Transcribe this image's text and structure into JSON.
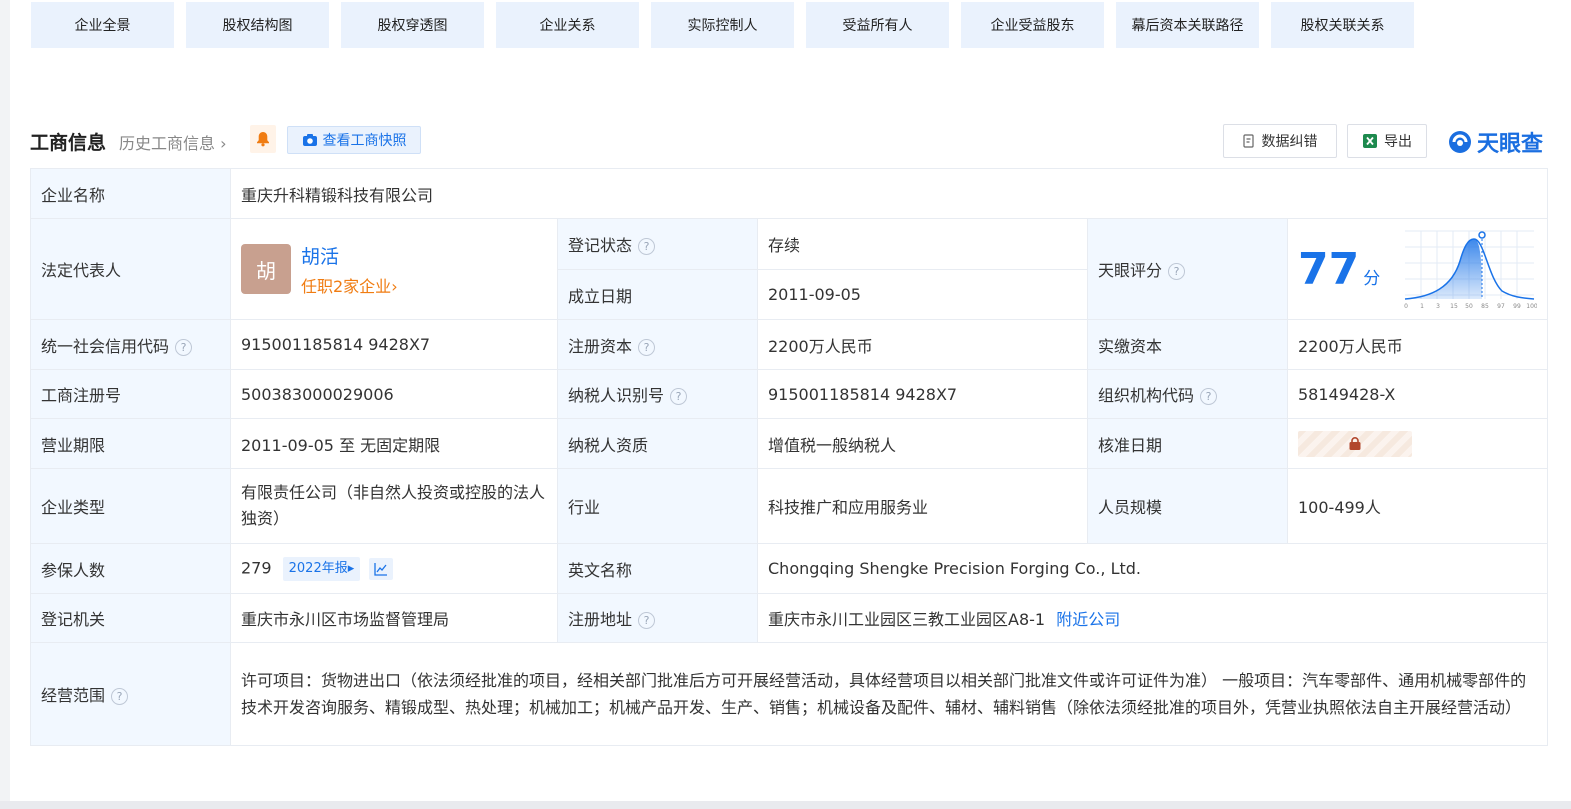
{
  "tabs": [
    "企业全景",
    "股权结构图",
    "股权穿透图",
    "企业关系",
    "实际控制人",
    "受益所有人",
    "企业受益股东",
    "幕后资本关联路径",
    "股权关联关系"
  ],
  "header": {
    "title": "工商信息",
    "history": "历史工商信息",
    "snapshot": "查看工商快照",
    "correct": "数据纠错",
    "export": "导出",
    "logo": "天眼查"
  },
  "info": {
    "company_name_label": "企业名称",
    "company_name": "重庆升科精锻科技有限公司",
    "legal_rep_label": "法定代表人",
    "legal_rep_avatar": "胡",
    "legal_rep_name": "胡活",
    "legal_rep_sub": "任职2家企业",
    "reg_status_label": "登记状态",
    "reg_status": "存续",
    "found_date_label": "成立日期",
    "found_date": "2011-09-05",
    "score_label": "天眼评分",
    "score": "77",
    "score_unit": "分",
    "score_ticks": [
      "0",
      "1",
      "3",
      "15",
      "50",
      "85",
      "97",
      "99",
      "100"
    ],
    "credit_code_label": "统一社会信用代码",
    "credit_code": "915001185814 9428X7",
    "reg_capital_label": "注册资本",
    "reg_capital": "2200万人民币",
    "paid_capital_label": "实缴资本",
    "paid_capital": "2200万人民币",
    "reg_no_label": "工商注册号",
    "reg_no": "500383000029006",
    "taxpayer_id_label": "纳税人识别号",
    "taxpayer_id": "915001185814 9428X7",
    "org_code_label": "组织机构代码",
    "org_code": "58149428-X",
    "term_label": "营业期限",
    "term": "2011-09-05 至 无固定期限",
    "tax_quality_label": "纳税人资质",
    "tax_quality": "增值税一般纳税人",
    "approve_date_label": "核准日期",
    "type_label": "企业类型",
    "type": "有限责任公司（非自然人投资或控股的法人独资）",
    "industry_label": "行业",
    "industry": "科技推广和应用服务业",
    "staff_label": "人员规模",
    "staff": "100-499人",
    "insured_label": "参保人数",
    "insured": "279",
    "insured_year": "2022年报",
    "en_name_label": "英文名称",
    "en_name": "Chongqing Shengke Precision Forging Co., Ltd.",
    "authority_label": "登记机关",
    "authority": "重庆市永川区市场监督管理局",
    "address_label": "注册地址",
    "address": "重庆市永川工业园区三教工业园区A8-1",
    "nearby": "附近公司",
    "scope_label": "经营范围",
    "scope": "许可项目：货物进出口（依法须经批准的项目，经相关部门批准后方可开展经营活动，具体经营项目以相关部门批准文件或许可证件为准） 一般项目：汽车零部件、通用机械零部件的技术开发咨询服务、精锻成型、热处理；机械加工；机械产品开发、生产、销售；机械设备及配件、辅材、辅料销售（除依法须经批准的项目外，凭营业执照依法自主开展经营活动）"
  }
}
